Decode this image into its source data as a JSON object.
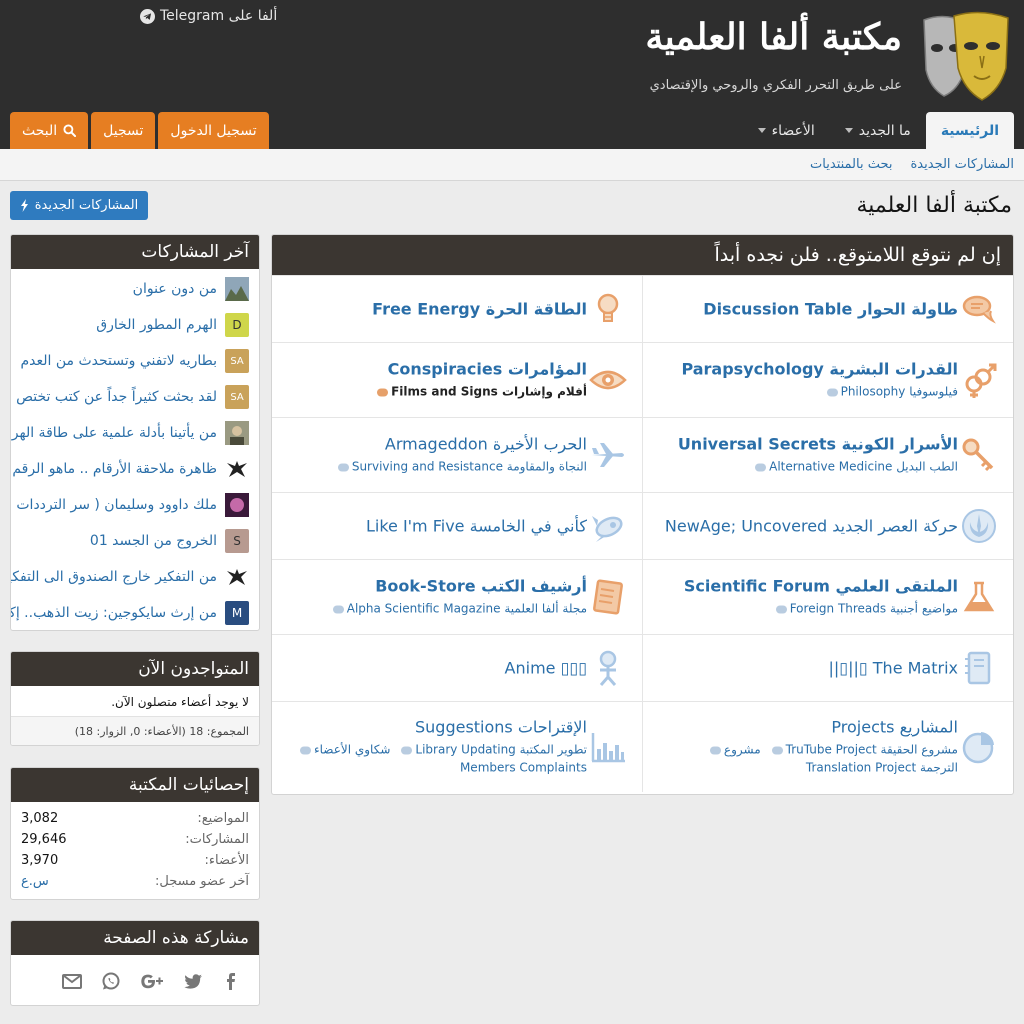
{
  "header": {
    "site_title": "مكتبة ألفا العلمية",
    "tagline": "على طريق التحرر الفكري والروحي والإقتصادي",
    "telegram_link": "ألفا على Telegram"
  },
  "nav": {
    "tabs": [
      {
        "label": "الرئيسية",
        "active": true
      },
      {
        "label": "ما الجديد",
        "dropdown": true
      },
      {
        "label": "الأعضاء",
        "dropdown": true
      }
    ],
    "login": "تسجيل الدخول",
    "register": "تسجيل",
    "search": "البحث"
  },
  "subnav": [
    "المشاركات الجديدة",
    "بحث بالمنتديات"
  ],
  "page": {
    "title": "مكتبة ألفا العلمية",
    "new_posts_button": "المشاركات الجديدة"
  },
  "main_block": {
    "title": "إن لم نتوقع اللامتوقع.. فلن نجده أبداً",
    "forums": [
      {
        "title": "طاولة الحوار Discussion Table",
        "bold": true,
        "icon": "chat-bubbles-icon",
        "subs": []
      },
      {
        "title": "الطاقة الحرة Free Energy",
        "bold": true,
        "icon": "lightbulb-icon",
        "subs": []
      },
      {
        "title": "القدرات البشرية Parapsychology",
        "bold": true,
        "icon": "gender-symbols-icon",
        "subs": [
          {
            "label": "فيلوسوفيا Philosophy",
            "bold": false
          }
        ]
      },
      {
        "title": "المؤامرات Conspiracies",
        "bold": true,
        "icon": "eye-icon",
        "subs": [
          {
            "label": "أفلام وإشارات Films and Signs",
            "bold": true
          }
        ]
      },
      {
        "title": "الأسرار الكونية Universal Secrets",
        "bold": true,
        "icon": "keys-icon",
        "subs": [
          {
            "label": "الطب البديل Alternative Medicine",
            "bold": false
          }
        ]
      },
      {
        "title": "الحرب الأخيرة Armageddon",
        "bold": false,
        "icon": "jet-plane-icon",
        "subs": [
          {
            "label": "النجاة والمقاومة Surviving and Resistance",
            "bold": false
          }
        ]
      },
      {
        "title": "حركة العصر الجديد NewAge; Uncovered",
        "bold": false,
        "icon": "rebel-alliance-icon",
        "subs": []
      },
      {
        "title": "كأني في الخامسة Like I'm Five",
        "bold": false,
        "icon": "rocket-ship-icon",
        "subs": []
      },
      {
        "title": "الملتقى العلمي Scientific Forum",
        "bold": true,
        "icon": "flask-icon",
        "subs": [
          {
            "label": "مواضيع أجنبية Foreign Threads",
            "bold": false
          }
        ]
      },
      {
        "title": "أرشيف الكتب Book-Store",
        "bold": true,
        "icon": "book-icon",
        "subs": [
          {
            "label": "مجلة ألفا العلمية Alpha Scientific Magazine",
            "bold": false
          }
        ]
      },
      {
        "title": "The Matrix ▯||▯||",
        "bold": false,
        "icon": "notebook-icon",
        "subs": []
      },
      {
        "title": "▯▯▯ Anime",
        "bold": false,
        "icon": "stick-figure-icon",
        "subs": []
      },
      {
        "title": "المشاريع Projects",
        "bold": false,
        "icon": "pie-chart-icon",
        "subs": [
          {
            "label": "مشروع الحقيقة TruTube Project",
            "bold": false
          },
          {
            "label": "مشروع",
            "bold": false
          },
          {
            "label": "الترجمة Translation Project",
            "bold": false
          }
        ]
      },
      {
        "title": "الإقتراحات Suggestions",
        "bold": false,
        "icon": "bar-chart-icon",
        "subs": [
          {
            "label": "تطوير المكتبة Library Updating",
            "bold": false
          },
          {
            "label": "شكاوي الأعضاء",
            "bold": false
          },
          {
            "label": "Members Complaints",
            "bold": false
          }
        ]
      }
    ]
  },
  "sidebar": {
    "latest_posts": {
      "title": "آخر المشاركات",
      "items": [
        {
          "title": "من دون عنوان",
          "avatar_text": "",
          "avatar_color": "#6f8a6a"
        },
        {
          "title": "الهرم المطور الخارق",
          "avatar_text": "D",
          "avatar_color": "#cfd64a"
        },
        {
          "title": "بطاريه لاتفني وتستحدث من العدم",
          "avatar_text": "SA",
          "avatar_color": "#c9a25a"
        },
        {
          "title": "لقد بحثت كثيراً جداً عن كتب تختص",
          "avatar_text": "SA",
          "avatar_color": "#c9a25a"
        },
        {
          "title": "من يأتينا بأدلة علمية على طاقة الهرم",
          "avatar_text": "",
          "avatar_color": "#8a8a72"
        },
        {
          "title": "ظاهرة ملاحقة الأرقام .. ماهو الرقم",
          "avatar_text": "",
          "avatar_color": "#ffffff"
        },
        {
          "title": "ملك داوود وسليمان ( سر الترددات",
          "avatar_text": "",
          "avatar_color": "#7a3a6a"
        },
        {
          "title": "الخروج من الجسد 01",
          "avatar_text": "S",
          "avatar_color": "#b79a90"
        },
        {
          "title": "من التفكير خارج الصندوق الى التفكير",
          "avatar_text": "",
          "avatar_color": "#ffffff"
        },
        {
          "title": "من إرث سايكوجين: زيت الذهب.. إكسير",
          "avatar_text": "M",
          "avatar_color": "#2a4d80"
        }
      ]
    },
    "online": {
      "title": "المتواجدون الآن",
      "text": "لا يوجد أعضاء متصلون الآن.",
      "total": "المجموع: 18 (الأعضاء: 0, الزوار: 18)"
    },
    "stats": {
      "title": "إحصائيات المكتبة",
      "rows": [
        {
          "label": "المواضيع:",
          "value": "3,082"
        },
        {
          "label": "المشاركات:",
          "value": "29,646"
        },
        {
          "label": "الأعضاء:",
          "value": "3,970"
        },
        {
          "label": "آخر عضو مسجل:",
          "value": "س.ع"
        }
      ]
    },
    "share": {
      "title": "مشاركة هذه الصفحة",
      "icons": [
        "facebook-icon",
        "twitter-icon",
        "google-plus-icon",
        "whatsapp-icon",
        "email-icon"
      ]
    }
  },
  "colors": {
    "header_bg": "#2e2e2e",
    "block_head_bg": "#3b3631",
    "accent_orange": "#e67e22",
    "link_blue": "#2a6ea8",
    "button_blue": "#2f7bbf",
    "forum_icon_orange": "#e8a06a",
    "forum_icon_blue": "#a9c6e4"
  }
}
